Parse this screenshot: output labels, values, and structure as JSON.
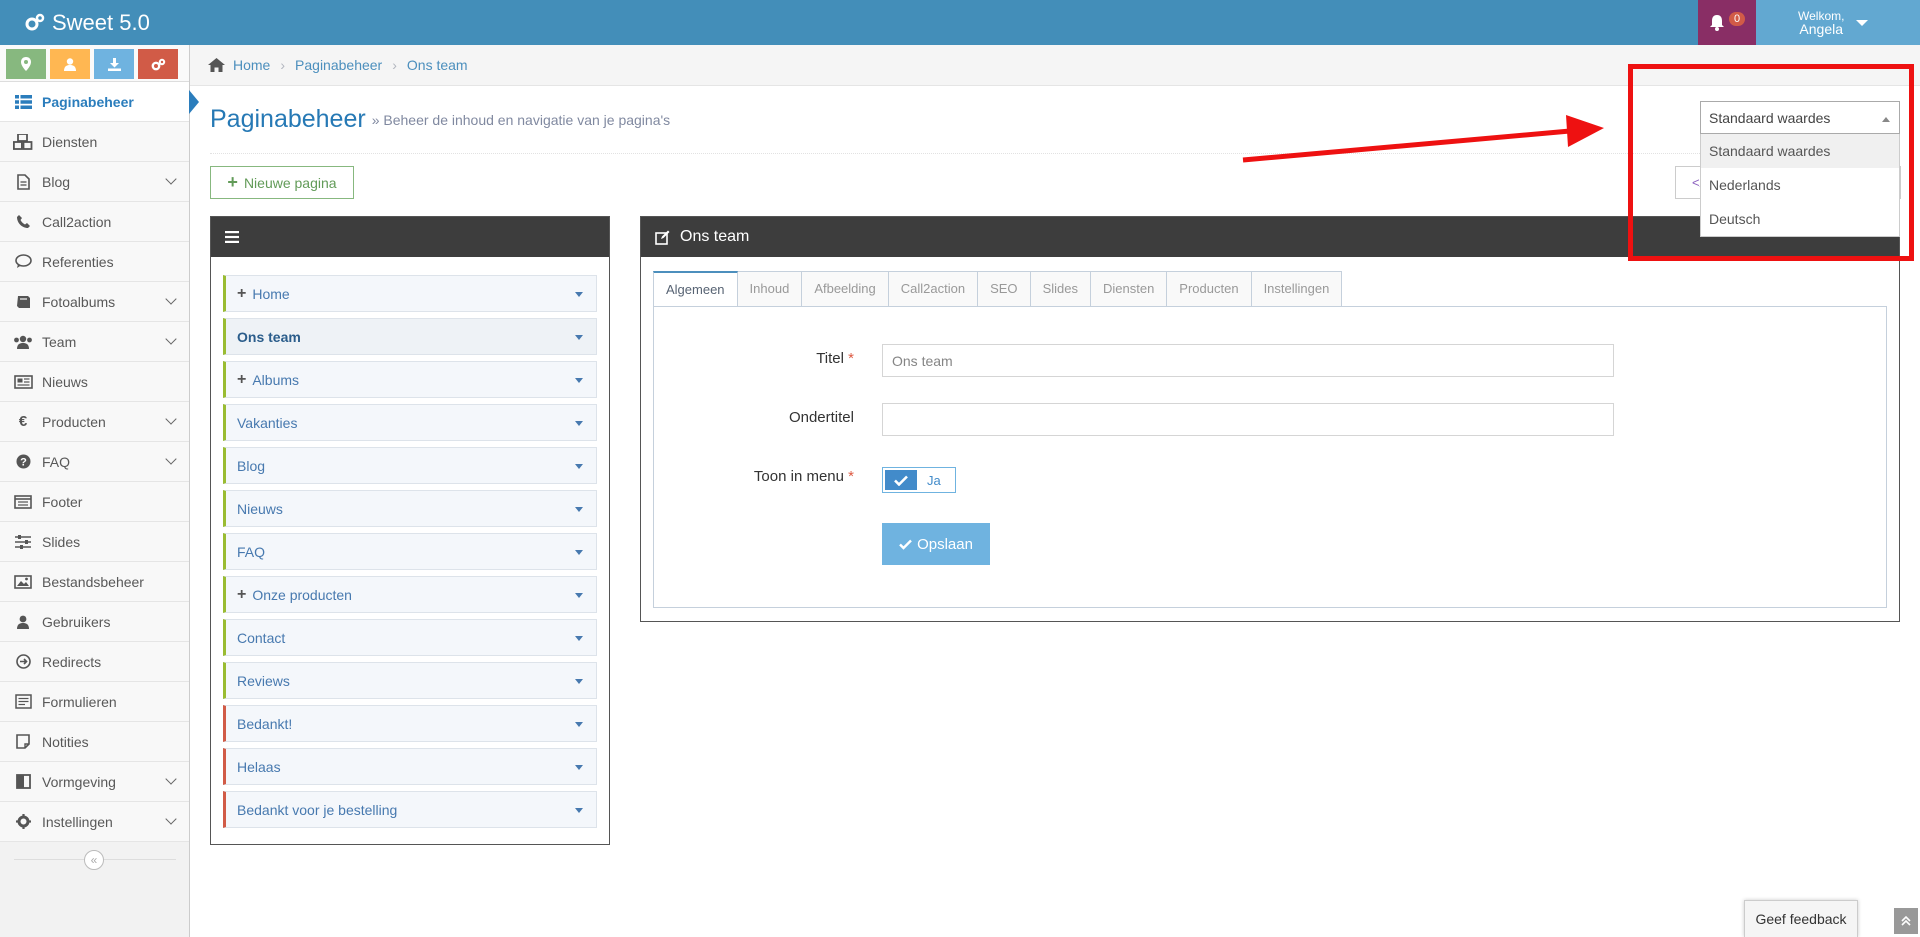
{
  "app": {
    "title": "Sweet 5.0"
  },
  "navbar": {
    "notifications_count": "0",
    "welcome": "Welkom,",
    "user_name": "Angela"
  },
  "shortcuts": [
    {
      "icon": "map-marker-icon",
      "color": "#87b87f"
    },
    {
      "icon": "user-icon",
      "color": "#ffb752"
    },
    {
      "icon": "download-icon",
      "color": "#6fb3e0"
    },
    {
      "icon": "cogs-icon",
      "color": "#d15b47"
    }
  ],
  "sidebar": {
    "items": [
      {
        "label": "Paginabeheer",
        "icon": "list-icon",
        "active": true,
        "submenu": false
      },
      {
        "label": "Diensten",
        "icon": "cubes-icon",
        "submenu": false
      },
      {
        "label": "Blog",
        "icon": "file-text-icon",
        "submenu": true
      },
      {
        "label": "Call2action",
        "icon": "phone-volume-icon",
        "submenu": false
      },
      {
        "label": "Referenties",
        "icon": "comment-icon",
        "submenu": false
      },
      {
        "label": "Fotoalbums",
        "icon": "book-icon",
        "submenu": true
      },
      {
        "label": "Team",
        "icon": "users-icon",
        "submenu": true
      },
      {
        "label": "Nieuws",
        "icon": "newspaper-icon",
        "submenu": false
      },
      {
        "label": "Producten",
        "icon": "euro-icon",
        "submenu": true
      },
      {
        "label": "FAQ",
        "icon": "question-circle-icon",
        "submenu": true
      },
      {
        "label": "Footer",
        "icon": "list-alt-icon",
        "submenu": false
      },
      {
        "label": "Slides",
        "icon": "sliders-icon",
        "submenu": false
      },
      {
        "label": "Bestandsbeheer",
        "icon": "image-icon",
        "submenu": false
      },
      {
        "label": "Gebruikers",
        "icon": "user-icon",
        "submenu": false
      },
      {
        "label": "Redirects",
        "icon": "arrow-circle-right-icon",
        "submenu": false
      },
      {
        "label": "Formulieren",
        "icon": "form-icon",
        "submenu": false
      },
      {
        "label": "Notities",
        "icon": "sticky-note-icon",
        "submenu": false
      },
      {
        "label": "Vormgeving",
        "icon": "columns-icon",
        "submenu": true
      },
      {
        "label": "Instellingen",
        "icon": "gear-icon",
        "submenu": true
      }
    ],
    "collapse_glyph": "«"
  },
  "breadcrumbs": [
    "Home",
    "Paginabeheer",
    "Ons team"
  ],
  "page": {
    "title": "Paginabeheer",
    "subtitle": "» Beheer de inhoud en navigatie van je pagina's",
    "new_page_label": "Nieuwe pagina",
    "code_button_label": "</"
  },
  "language": {
    "selected": "Standaard waardes",
    "options": [
      "Standaard waardes",
      "Nederlands",
      "Deutsch"
    ]
  },
  "tree": {
    "items": [
      {
        "label": "Home",
        "expandable": true,
        "color": "green"
      },
      {
        "label": "Ons team",
        "expandable": false,
        "color": "green",
        "active": true
      },
      {
        "label": "Albums",
        "expandable": true,
        "color": "green"
      },
      {
        "label": "Vakanties",
        "expandable": false,
        "color": "green"
      },
      {
        "label": "Blog",
        "expandable": false,
        "color": "green"
      },
      {
        "label": "Nieuws",
        "expandable": false,
        "color": "green"
      },
      {
        "label": "FAQ",
        "expandable": false,
        "color": "green"
      },
      {
        "label": "Onze producten",
        "expandable": true,
        "color": "green"
      },
      {
        "label": "Contact",
        "expandable": false,
        "color": "green"
      },
      {
        "label": "Reviews",
        "expandable": false,
        "color": "green"
      },
      {
        "label": "Bedankt!",
        "expandable": false,
        "color": "red"
      },
      {
        "label": "Helaas",
        "expandable": false,
        "color": "red"
      },
      {
        "label": "Bedankt voor je bestelling",
        "expandable": false,
        "color": "red"
      }
    ]
  },
  "editor": {
    "title": "Ons team",
    "tabs": [
      "Algemeen",
      "Inhoud",
      "Afbeelding",
      "Call2action",
      "SEO",
      "Slides",
      "Diensten",
      "Producten",
      "Instellingen"
    ],
    "active_tab": "Algemeen",
    "fields": {
      "titel_label": "Titel",
      "titel_value": "Ons team",
      "ondertitel_label": "Ondertitel",
      "ondertitel_value": "",
      "toon_label": "Toon in menu",
      "toon_value": "Ja",
      "required_mark": "*"
    },
    "save_label": "Opslaan"
  },
  "feedback": {
    "label": "Geef feedback"
  },
  "colors": {
    "navbar": "#438eb9",
    "accent": "#2b7dbc",
    "annotation": "#ee1111"
  }
}
